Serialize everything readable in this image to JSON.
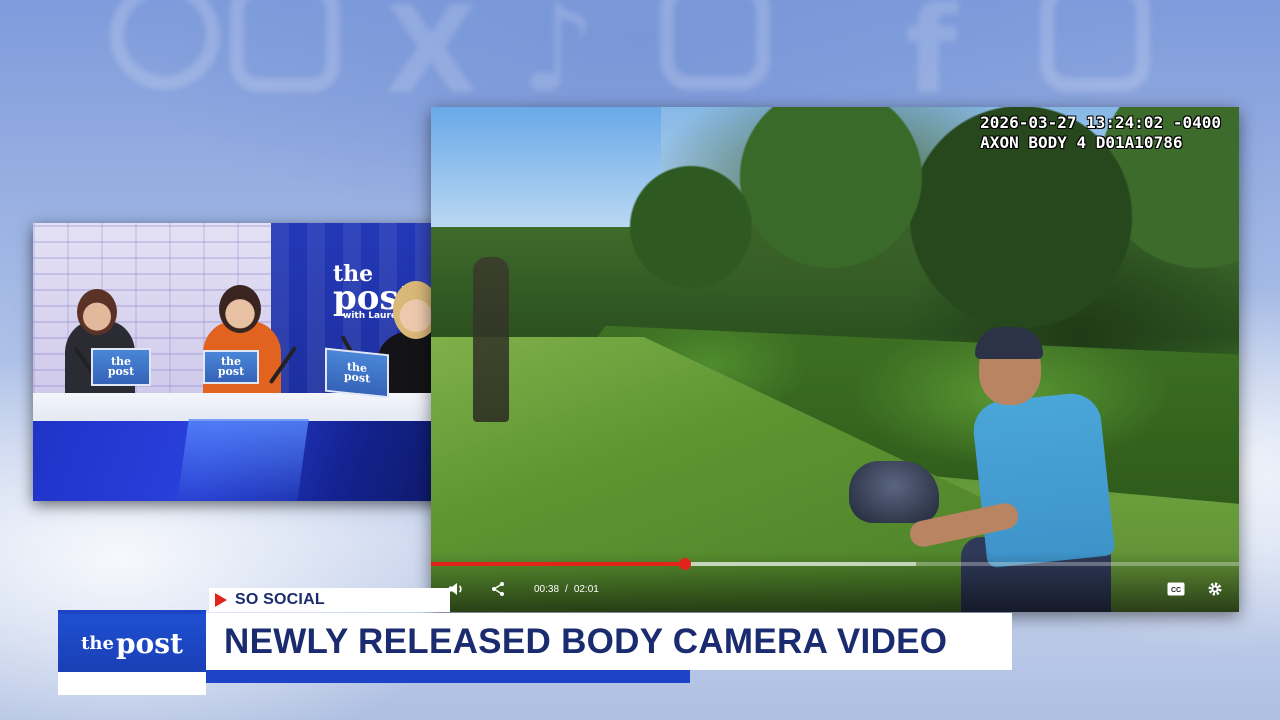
{
  "background": {
    "icons": [
      "instagram-icon",
      "x-icon",
      "tiktok-icon",
      "youtube-icon",
      "facebook-icon"
    ]
  },
  "studio": {
    "wall_logo": {
      "line1": "the",
      "line2": "post",
      "line3": "with Lauren"
    },
    "desk_sign": {
      "line1": "the",
      "line2": "post"
    }
  },
  "player": {
    "overlay": {
      "timestamp": "2026-03-27 13:24:02 -0400",
      "device": "AXON BODY 4 D01A10786"
    },
    "current_time": "00:38",
    "separator": "/",
    "duration": "02:01",
    "progress_fraction": 0.314,
    "buffered_fraction": 0.6,
    "cc_label": "CC",
    "colors": {
      "progress": "#e2231a"
    }
  },
  "lower_third": {
    "logo": {
      "small": "the",
      "large": "post"
    },
    "tag": "SO SOCIAL",
    "headline": "NEWLY RELEASED BODY CAMERA VIDEO",
    "colors": {
      "navy": "#1a2b6f",
      "blue": "#1d44c6",
      "red": "#e2231a"
    }
  }
}
